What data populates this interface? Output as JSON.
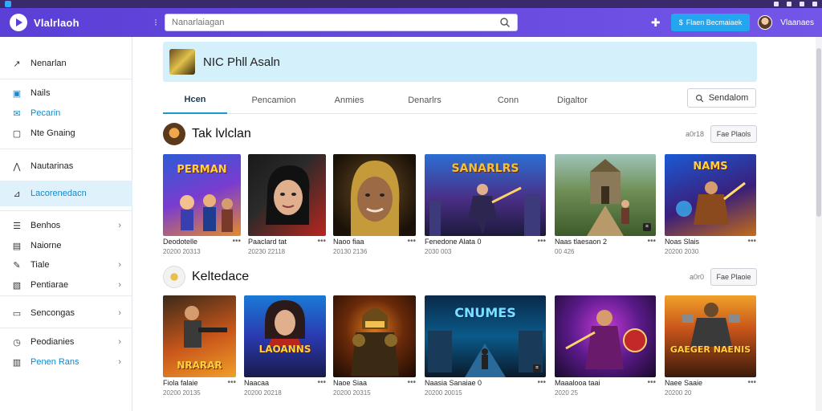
{
  "app": {
    "name": "Vlalrlaoh"
  },
  "search": {
    "placeholder": "Nanarlaiagan"
  },
  "header": {
    "promo_label": "Flaen Becmaiaek",
    "user_name": "Vlaanaes"
  },
  "sidebar": {
    "items": [
      {
        "label": "Nenarlan",
        "icon": "trend-icon"
      },
      {
        "label": "Nails",
        "icon": "video-icon"
      },
      {
        "label": "Pecarin",
        "icon": "mail-icon"
      },
      {
        "label": "Nte Gnaing",
        "icon": "folder-icon"
      },
      {
        "label": "Nautarinas",
        "icon": "chart-icon"
      },
      {
        "label": "Lacorenedacn",
        "icon": "graph-icon"
      },
      {
        "label": "Benhos",
        "icon": "list-icon"
      },
      {
        "label": "Naiorne",
        "icon": "image-icon"
      },
      {
        "label": "Tiale",
        "icon": "edit-icon"
      },
      {
        "label": "Pentiarae",
        "icon": "doc-icon"
      },
      {
        "label": "Sencongas",
        "icon": "queue-icon"
      },
      {
        "label": "Peodianies",
        "icon": "clock-icon"
      },
      {
        "label": "Penen Rans",
        "icon": "db-icon"
      }
    ]
  },
  "channel": {
    "name": "NIC Phll Asaln"
  },
  "tabs": [
    "Hcen",
    "Pencamion",
    "Anmies",
    "Denarlrs",
    "Conn",
    "Digaltor"
  ],
  "sort_label": "Sendalom",
  "sections": [
    {
      "title": "Tak lvlclan",
      "count": "a0r18",
      "see_all": "Fae Plaols",
      "cards": [
        {
          "title": "Deodotelle",
          "meta": "20200 20313",
          "art": "PERMAN"
        },
        {
          "title": "Paaclard tat",
          "meta": "20230 22118",
          "art": ""
        },
        {
          "title": "Naoo fiaa",
          "meta": "20130 2136",
          "art": ""
        },
        {
          "title": "Fenedone Alata 0",
          "meta": "2030 003",
          "art": "SANARLRS"
        },
        {
          "title": "Naas tlaesaon 2",
          "meta": "00 426",
          "art": ""
        },
        {
          "title": "Noas Slais",
          "meta": "20200 2030",
          "art": "NAMS"
        }
      ]
    },
    {
      "title": "Keltedace",
      "count": "a0r0",
      "see_all": "Fae Plaoie",
      "cards": [
        {
          "title": "Fiola falaie",
          "meta": "20200 20135",
          "art": "NRARAR"
        },
        {
          "title": "Naacaa",
          "meta": "20200 20218",
          "art": "LAOANNS"
        },
        {
          "title": "Naoe Siaa",
          "meta": "20200 20315",
          "art": ""
        },
        {
          "title": "Naasia Sanaiae 0",
          "meta": "20200 20015",
          "art": "CNUMES"
        },
        {
          "title": "Maaalooa taai",
          "meta": "2020 25",
          "art": ""
        },
        {
          "title": "Naee Saaie",
          "meta": "20200 20",
          "art": "GAEGER NAENIS"
        }
      ]
    }
  ]
}
